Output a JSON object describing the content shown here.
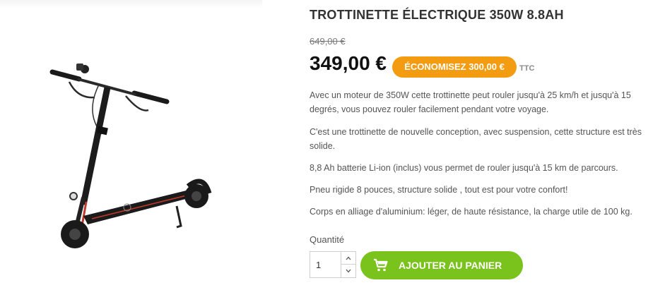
{
  "product": {
    "title": "TROTTINETTE ÉLECTRIQUE 350W 8.8AH",
    "old_price": "649,00 €",
    "price": "349,00 €",
    "save_badge": "ÉCONOMISEZ 300,00 €",
    "tax_label": "TTC",
    "description": [
      "Avec un moteur de 350W cette trottinette peut rouler jusqu'à 25 km/h et jusqu'à 15 degrés, vous pouvez rouler facilement pendant votre voyage.",
      "C'est une trottinette de nouvelle conception, avec suspension, cette structure est très solide.",
      "8,8 Ah batterie Li-ion (inclus) vous permet de rouler jusqu'à 15 km de parcours.",
      "Pneu rigide 8 pouces, structure solide , tout est pour votre confort!",
      "Corps en alliage d'aluminium: léger, de haute résistance, la charge utile de 100 kg."
    ]
  },
  "purchase": {
    "quantity_label": "Quantité",
    "quantity_value": "1",
    "add_to_cart_label": "AJOUTER AU PANIER",
    "add_to_cart_icon": "cart-icon"
  },
  "colors": {
    "save_badge": "#f39c12",
    "add_to_cart": "#7ac21c",
    "title": "#333333"
  },
  "image": {
    "icon": "electric-scooter-image"
  }
}
